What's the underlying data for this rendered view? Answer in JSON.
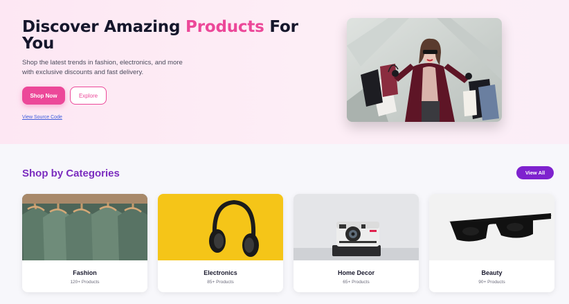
{
  "hero": {
    "title_pre": "Discover Amazing ",
    "title_accent": "Products",
    "title_post": " For You",
    "subtitle": "Shop the latest trends in fashion, electronics, and more with exclusive discounts and fast delivery.",
    "shop_now_label": "Shop Now",
    "explore_label": "Explore",
    "source_link": "View Source Code"
  },
  "categories": {
    "title": "Shop by Categories",
    "view_all_label": "View All",
    "items": [
      {
        "name": "Fashion",
        "count": "120+ Products"
      },
      {
        "name": "Electronics",
        "count": "85+ Products"
      },
      {
        "name": "Home Decor",
        "count": "65+ Products"
      },
      {
        "name": "Beauty",
        "count": "90+ Products"
      }
    ]
  },
  "colors": {
    "accent_pink": "#ec4899",
    "accent_purple": "#7e22ce",
    "electronics_bg": "#f5c518"
  }
}
